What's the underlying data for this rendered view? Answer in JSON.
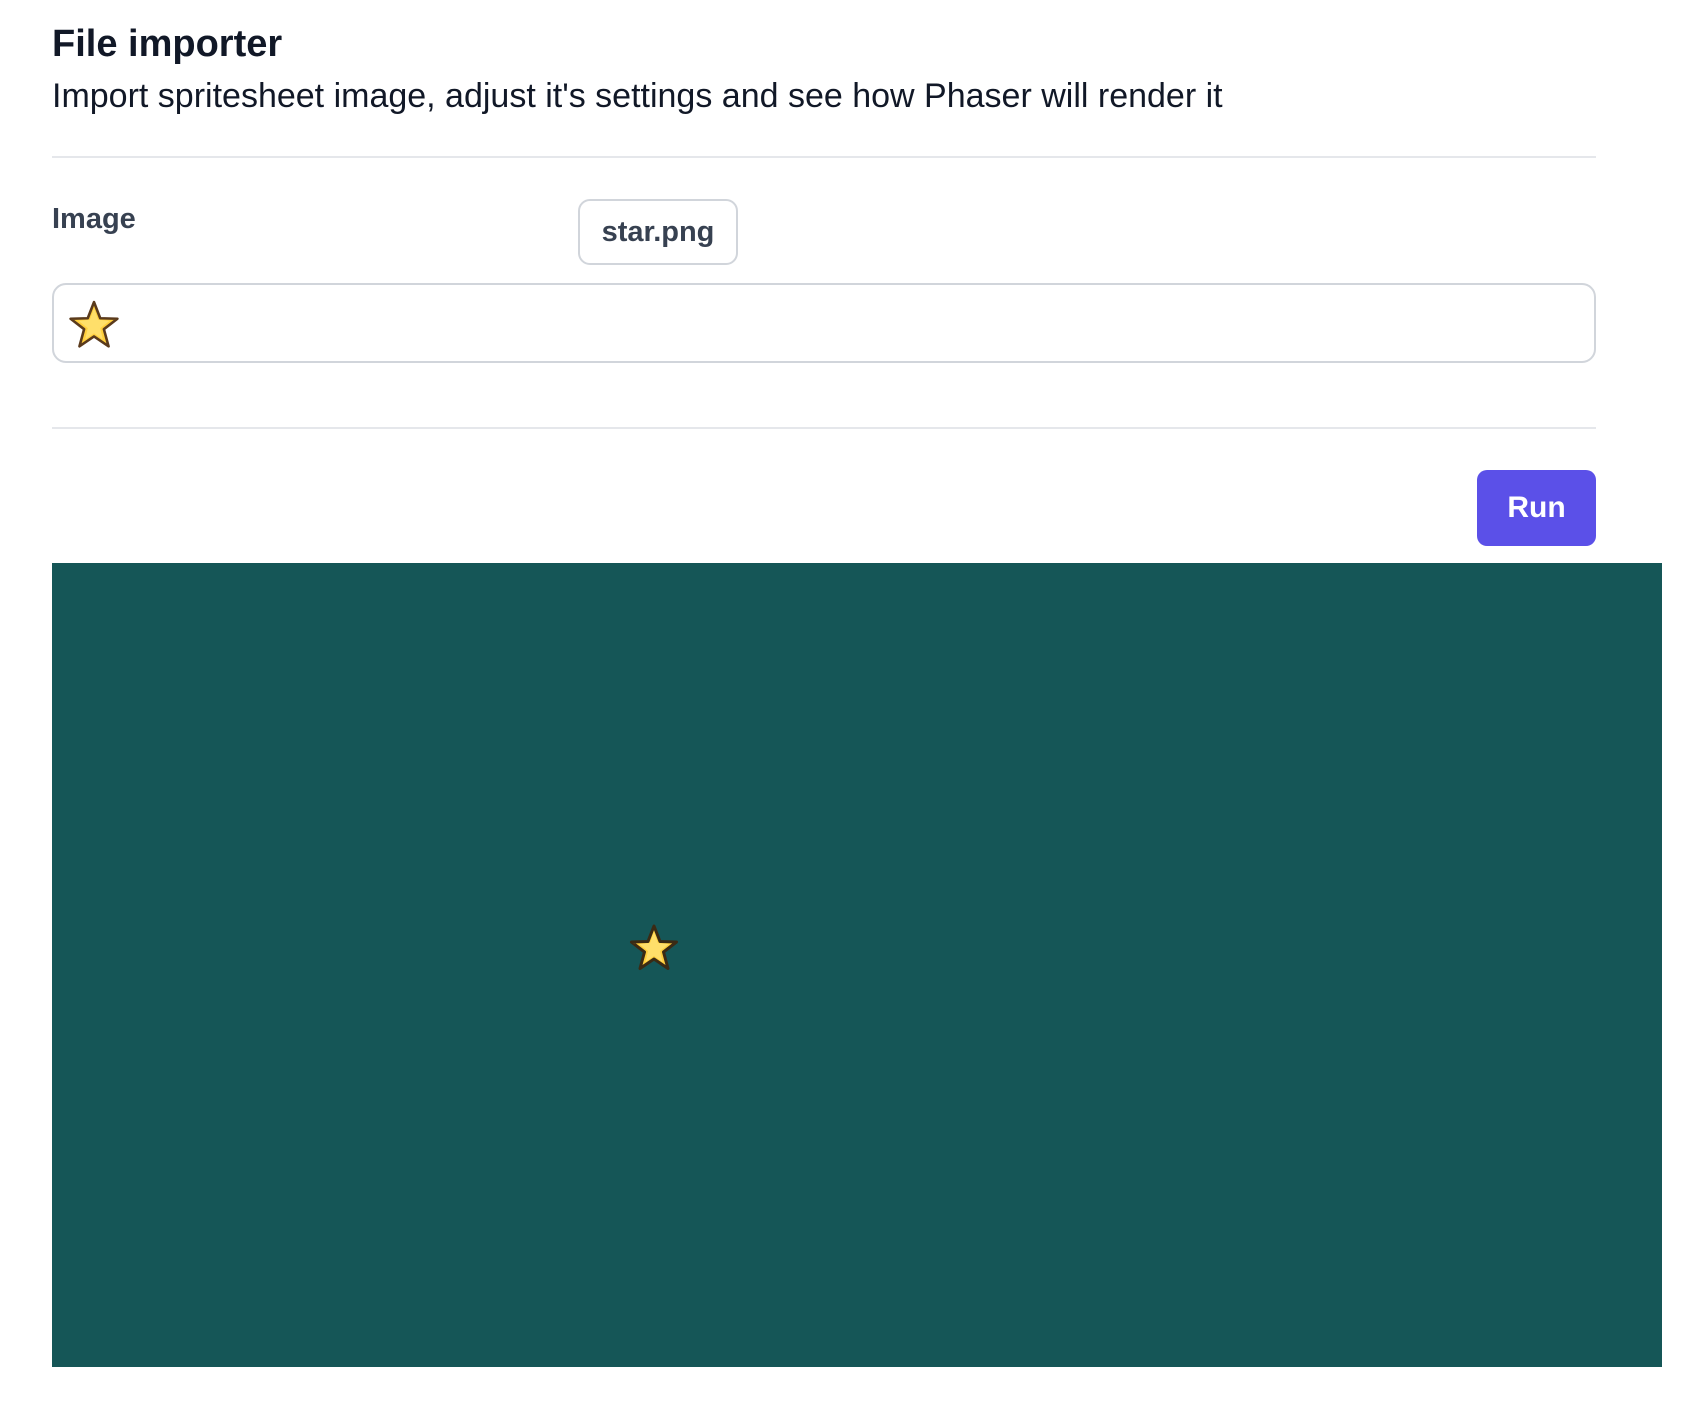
{
  "header": {
    "title": "File importer",
    "subtitle": "Import spritesheet image, adjust it's settings and see how Phaser will render it"
  },
  "form": {
    "image_label": "Image",
    "file_name": "star.png",
    "preview_icon": "star-icon"
  },
  "actions": {
    "run_label": "Run"
  },
  "canvas": {
    "background_color": "#155657",
    "sprite_icon": "star-icon"
  },
  "colors": {
    "accent": "#5b50e8",
    "star_fill": "#ffcf3d",
    "star_outline": "#5a3a1c"
  }
}
